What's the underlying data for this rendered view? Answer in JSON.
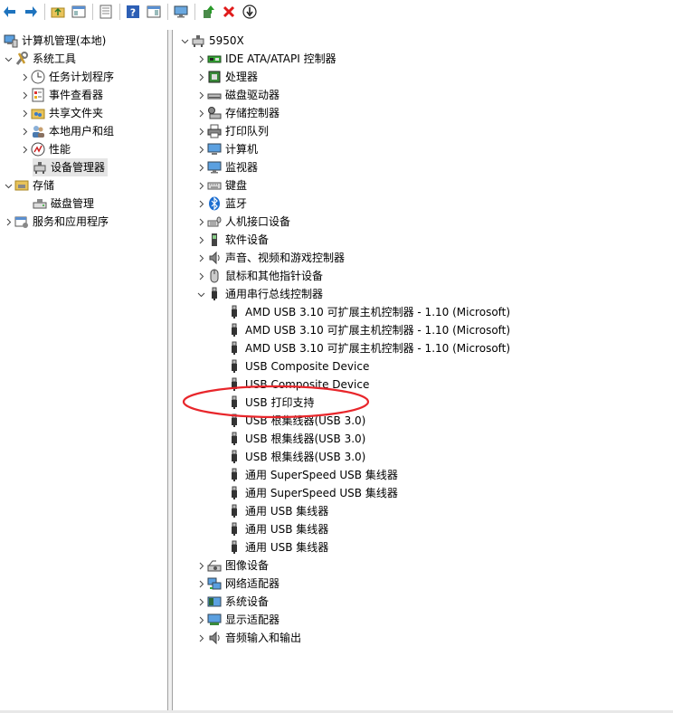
{
  "left_tree": {
    "root": "计算机管理(本地)",
    "system_tools": "系统工具",
    "task_scheduler": "任务计划程序",
    "event_viewer": "事件查看器",
    "shared_folders": "共享文件夹",
    "local_users": "本地用户和组",
    "performance": "性能",
    "device_manager": "设备管理器",
    "storage": "存储",
    "disk_management": "磁盘管理",
    "services_apps": "服务和应用程序"
  },
  "right_tree": {
    "computer": "5950X",
    "categories": [
      "IDE ATA/ATAPI 控制器",
      "处理器",
      "磁盘驱动器",
      "存储控制器",
      "打印队列",
      "计算机",
      "监视器",
      "键盘",
      "蓝牙",
      "人机接口设备",
      "软件设备",
      "声音、视频和游戏控制器",
      "鼠标和其他指针设备",
      "通用串行总线控制器"
    ],
    "usb_devices": [
      "AMD USB 3.10 可扩展主机控制器 - 1.10 (Microsoft)",
      "AMD USB 3.10 可扩展主机控制器 - 1.10 (Microsoft)",
      "AMD USB 3.10 可扩展主机控制器 - 1.10 (Microsoft)",
      "USB Composite Device",
      "USB Composite Device",
      "USB 打印支持",
      "USB 根集线器(USB 3.0)",
      "USB 根集线器(USB 3.0)",
      "USB 根集线器(USB 3.0)",
      "通用 SuperSpeed USB 集线器",
      "通用 SuperSpeed USB 集线器",
      "通用 USB 集线器",
      "通用 USB 集线器",
      "通用 USB 集线器"
    ],
    "categories_after": [
      "图像设备",
      "网络适配器",
      "系统设备",
      "显示适配器",
      "音频输入和输出"
    ]
  },
  "colors": {
    "annotation": "#e8262b",
    "selection": "#e5e5e5"
  },
  "toolbar_icons": [
    "back-arrow-icon",
    "forward-arrow-icon",
    "up-folder-icon",
    "show-tree-icon",
    "properties-icon",
    "help-icon",
    "action-pane-icon",
    "monitor-icon",
    "update-driver-icon",
    "uninstall-icon",
    "disable-device-icon"
  ]
}
